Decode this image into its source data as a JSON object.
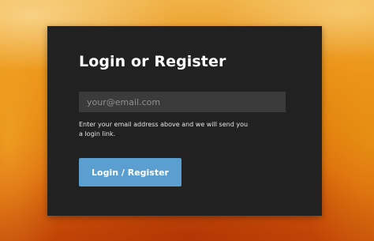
{
  "form": {
    "title": "Login or Register",
    "email_placeholder": "your@email.com",
    "email_value": "",
    "help_text": "Enter your email address above and we will send you a login link.",
    "submit_label": "Login / Register"
  },
  "colors": {
    "card_background": "#212121",
    "input_background": "#3b3b3b",
    "button_background": "#5b9fd1",
    "background_accent": "#e07a0c"
  }
}
